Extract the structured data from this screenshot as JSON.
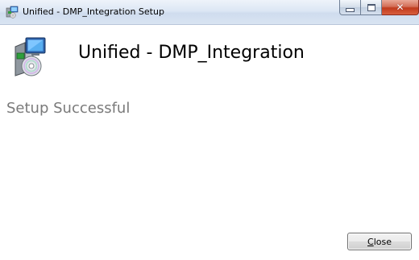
{
  "window": {
    "title": "Unified - DMP_Integration Setup",
    "caption_buttons": {
      "minimize_icon": "minimize-icon",
      "maximize_icon": "maximize-icon",
      "close_glyph": "✕",
      "close_color": "#c7432a"
    }
  },
  "header": {
    "icon": "installer-package-icon",
    "title": "Unified - DMP_Integration"
  },
  "main": {
    "status_text": "Setup Successful"
  },
  "footer": {
    "close_accel": "C",
    "close_rest": "lose"
  }
}
